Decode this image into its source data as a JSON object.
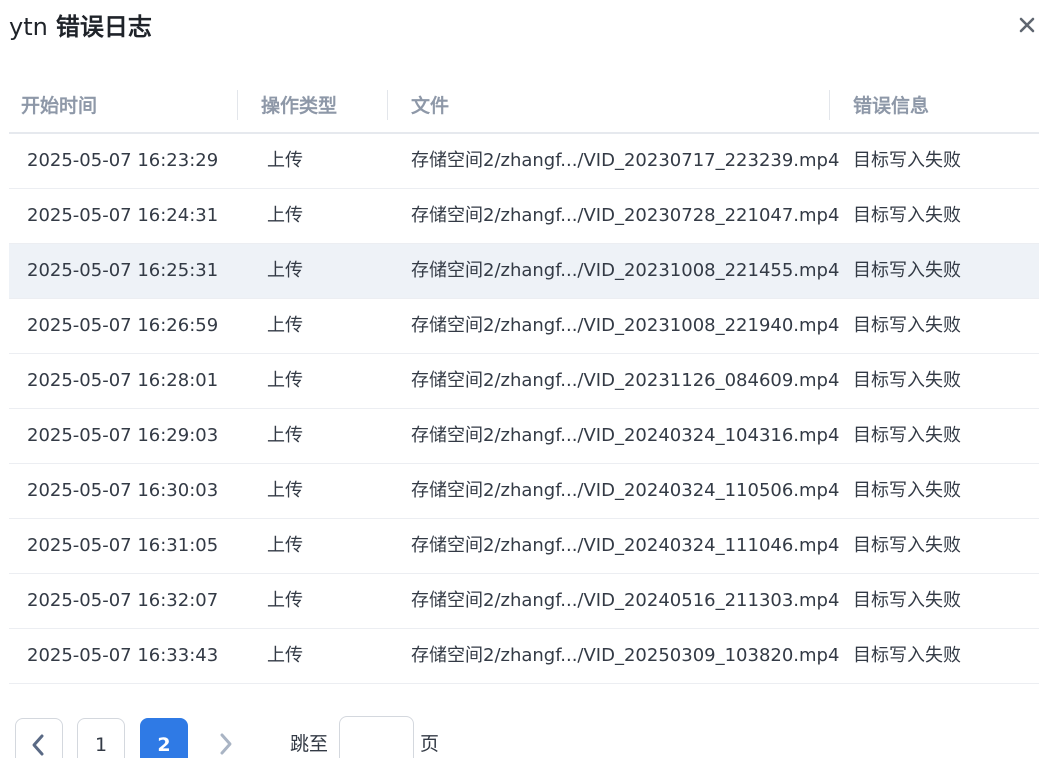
{
  "dialog": {
    "app_name": "ytn",
    "title": "错误日志",
    "close_icon": "close-icon"
  },
  "table": {
    "columns": [
      "开始时间",
      "操作类型",
      "文件",
      "错误信息"
    ],
    "rows": [
      {
        "time": "2025-05-07 16:23:29",
        "op": "上传",
        "file": "存储空间2/zhangf.../VID_20230717_223239.mp4",
        "error": "目标写入失败"
      },
      {
        "time": "2025-05-07 16:24:31",
        "op": "上传",
        "file": "存储空间2/zhangf.../VID_20230728_221047.mp4",
        "error": "目标写入失败"
      },
      {
        "time": "2025-05-07 16:25:31",
        "op": "上传",
        "file": "存储空间2/zhangf.../VID_20231008_221455.mp4",
        "error": "目标写入失败"
      },
      {
        "time": "2025-05-07 16:26:59",
        "op": "上传",
        "file": "存储空间2/zhangf.../VID_20231008_221940.mp4",
        "error": "目标写入失败"
      },
      {
        "time": "2025-05-07 16:28:01",
        "op": "上传",
        "file": "存储空间2/zhangf.../VID_20231126_084609.mp4",
        "error": "目标写入失败"
      },
      {
        "time": "2025-05-07 16:29:03",
        "op": "上传",
        "file": "存储空间2/zhangf.../VID_20240324_104316.mp4",
        "error": "目标写入失败"
      },
      {
        "time": "2025-05-07 16:30:03",
        "op": "上传",
        "file": "存储空间2/zhangf.../VID_20240324_110506.mp4",
        "error": "目标写入失败"
      },
      {
        "time": "2025-05-07 16:31:05",
        "op": "上传",
        "file": "存储空间2/zhangf.../VID_20240324_111046.mp4",
        "error": "目标写入失败"
      },
      {
        "time": "2025-05-07 16:32:07",
        "op": "上传",
        "file": "存储空间2/zhangf.../VID_20240516_211303.mp4",
        "error": "目标写入失败"
      },
      {
        "time": "2025-05-07 16:33:43",
        "op": "上传",
        "file": "存储空间2/zhangf.../VID_20250309_103820.mp4",
        "error": "目标写入失败"
      }
    ],
    "highlighted_row": 2
  },
  "pagination": {
    "prev_icon": "chevron-left-icon",
    "next_icon": "chevron-right-icon",
    "pages": [
      "1",
      "2"
    ],
    "current_page": "2",
    "jump_label": "跳至",
    "jump_value": "",
    "page_unit": "页"
  },
  "colors": {
    "accent": "#2f7ae5",
    "header_text": "#8e98a8",
    "row_highlight": "#eef2f7"
  }
}
